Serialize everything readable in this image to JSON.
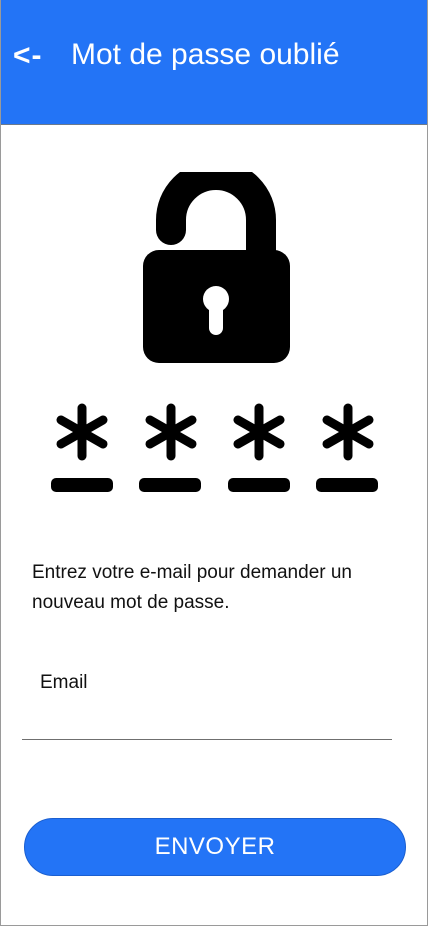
{
  "header": {
    "back_label": "<-",
    "title": "Mot de passe oublié",
    "background_color": "#2374f6"
  },
  "illustration": {
    "lock_icon": "unlocked-padlock-icon",
    "masked_characters": [
      "*",
      "*",
      "*",
      "*"
    ]
  },
  "form": {
    "instruction": "Entrez votre e-mail pour demander un nouveau mot de passe.",
    "email_label": "Email",
    "email_value": "",
    "submit_label": "ENVOYER",
    "button_color": "#2374f6"
  }
}
